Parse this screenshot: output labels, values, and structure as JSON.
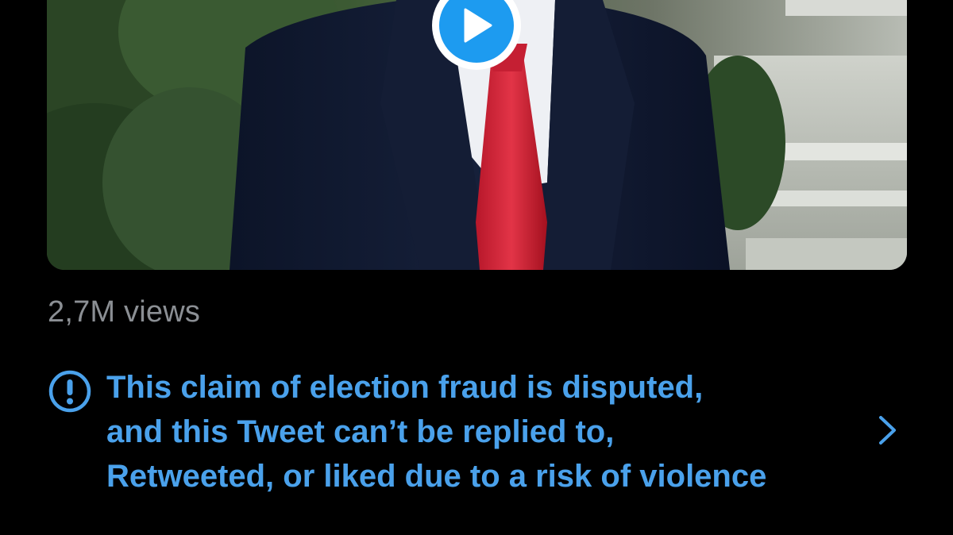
{
  "tweet": {
    "video": {
      "play_icon": "play-icon",
      "accent_color": "#1d9bf0"
    },
    "views_text": "2,7M views",
    "notice": {
      "icon": "exclamation-circle-icon",
      "lines": [
        "This claim of election fraud is disputed,",
        "and this Tweet can’t be replied to,",
        "Retweeted, or liked due to a risk of violence"
      ],
      "chevron_icon": "chevron-right-icon",
      "color": "#4aa1eb"
    }
  }
}
